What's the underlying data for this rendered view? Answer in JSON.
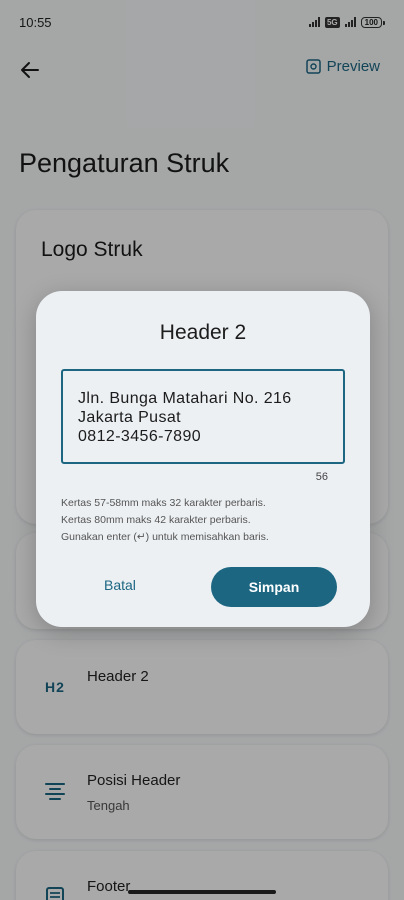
{
  "status": {
    "time": "10:55",
    "network": "5G",
    "battery": "100"
  },
  "top_bar": {
    "preview_label": "Preview"
  },
  "page": {
    "title": "Pengaturan Struk"
  },
  "logo_card": {
    "title": "Logo Struk"
  },
  "settings": {
    "header2": {
      "label": "Header 2",
      "icon": "H2"
    },
    "posisi_header": {
      "label": "Posisi Header",
      "value": "Tengah"
    },
    "footer": {
      "label": "Footer"
    }
  },
  "dialog": {
    "title": "Header 2",
    "value_lines": [
      "Jln. Bunga Matahari No. 216",
      "Jakarta Pusat",
      "0812-3456-7890"
    ],
    "char_count": "56",
    "help_lines": [
      "Kertas 57-58mm maks 32 karakter perbaris.",
      "Kertas 80mm maks 42 karakter perbaris.",
      "Gunakan enter (↵) untuk memisahkan baris."
    ],
    "cancel_label": "Batal",
    "save_label": "Simpan"
  },
  "colors": {
    "accent": "#1c6682",
    "scrim": "rgba(0,0,0,0.33)",
    "dialog_bg": "#ecf0f3"
  }
}
